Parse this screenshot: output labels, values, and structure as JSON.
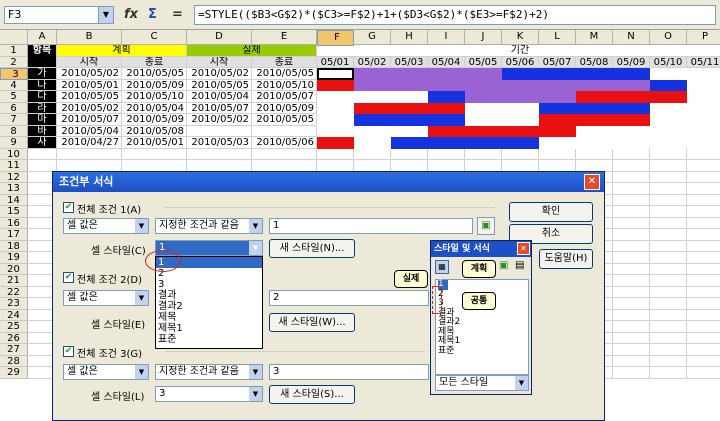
{
  "formula_bar": {
    "cell_ref": "F3",
    "fx_icon": "function-wizard-icon",
    "sum_icon": "sum-icon",
    "eq": "=",
    "formula": "=STYLE(($B3<G$2)*($C3>=F$2)+1+($D3<G$2)*($E3>=F$2)+2)"
  },
  "columns": [
    "A",
    "B",
    "C",
    "D",
    "E",
    "F",
    "G",
    "H",
    "I",
    "J",
    "K",
    "L",
    "M",
    "N",
    "O",
    "P"
  ],
  "rows": [
    "1",
    "2",
    "3",
    "4",
    "5",
    "6",
    "7",
    "8",
    "9",
    "10",
    "11",
    "12",
    "13",
    "14",
    "15",
    "16",
    "17",
    "18",
    "19",
    "20",
    "21",
    "22",
    "23",
    "24",
    "25",
    "26",
    "27",
    "28",
    "29"
  ],
  "sheet": {
    "header1": {
      "item": "항목",
      "plan": "계획",
      "actual": "실제",
      "period": "기간"
    },
    "header2": {
      "start1": "시작",
      "end1": "종료",
      "start2": "시작",
      "end2": "종료"
    },
    "dates": [
      "05/01",
      "05/02",
      "05/03",
      "05/04",
      "05/05",
      "05/06",
      "05/07",
      "05/08",
      "05/09",
      "05/10",
      "05/11"
    ],
    "data": [
      {
        "item": "가",
        "ps": "2010/05/02",
        "pe": "2010/05/05",
        "as": "2010/05/02",
        "ae": "2010/05/05"
      },
      {
        "item": "나",
        "ps": "2010/05/01",
        "pe": "2010/05/09",
        "as": "2010/05/05",
        "ae": "2010/05/10"
      },
      {
        "item": "다",
        "ps": "2010/05/05",
        "pe": "2010/05/10",
        "as": "2010/05/04",
        "ae": "2010/05/07"
      },
      {
        "item": "라",
        "ps": "2010/05/02",
        "pe": "2010/05/04",
        "as": "2010/05/07",
        "ae": "2010/05/09"
      },
      {
        "item": "마",
        "ps": "2010/05/07",
        "pe": "2010/05/09",
        "as": "2010/05/02",
        "ae": "2010/05/05"
      },
      {
        "item": "바",
        "ps": "2010/05/04",
        "pe": "2010/05/08",
        "as": "",
        "ae": ""
      },
      {
        "item": "사",
        "ps": "2010/04/27",
        "pe": "2010/05/01",
        "as": "2010/05/03",
        "ae": "2010/05/06"
      }
    ]
  },
  "gantt": {
    "colors": {
      "plan": "#e81010",
      "actual": "#1432e0",
      "common": "#9b62d4"
    },
    "rows": [
      [
        "w",
        "c",
        "c",
        "c",
        "c",
        "b",
        "b",
        "b",
        "b",
        "w",
        "w"
      ],
      [
        "r",
        "c",
        "c",
        "c",
        "c",
        "c",
        "c",
        "c",
        "c",
        "b",
        "w"
      ],
      [
        "w",
        "w",
        "w",
        "b",
        "c",
        "c",
        "c",
        "r",
        "r",
        "r",
        "w"
      ],
      [
        "w",
        "r",
        "r",
        "r",
        "w",
        "w",
        "b",
        "b",
        "b",
        "w",
        "w"
      ],
      [
        "w",
        "b",
        "b",
        "b",
        "w",
        "w",
        "r",
        "r",
        "r",
        "w",
        "w"
      ],
      [
        "w",
        "w",
        "w",
        "r",
        "r",
        "r",
        "r",
        "w",
        "w",
        "w",
        "w"
      ],
      [
        "r",
        "w",
        "b",
        "b",
        "b",
        "b",
        "w",
        "w",
        "w",
        "w",
        "w"
      ]
    ]
  },
  "dialog": {
    "title": "조건부 서식",
    "close": "✕",
    "cond1": {
      "label": "전체 조건 1(A)",
      "type": "셀 값은",
      "op": "지정한 조건과 같음",
      "value": "1",
      "style_label": "셀 스타일(C)",
      "style": "1",
      "new_style": "새 스타일(N)..."
    },
    "cond2": {
      "label": "전체 조건 2(D)",
      "type": "셀 값은",
      "value": "2",
      "style_label": "셀 스타일(E)",
      "new_style": "새 스타일(W)..."
    },
    "cond3": {
      "label": "전체 조건 3(G)",
      "type": "셀 값은",
      "op": "지정한 조건과 같음",
      "value": "3",
      "style_label": "셀 스타일(L)",
      "style": "3",
      "new_style": "새 스타일(S)..."
    },
    "ok": "확인",
    "cancel": "취소",
    "help": "도움말(H)",
    "dropdown": [
      "1",
      "2",
      "3",
      "결과",
      "결과2",
      "제목",
      "제목1",
      "표준"
    ]
  },
  "styles_panel": {
    "title": "스타일 및 서식",
    "items": [
      "1",
      "2",
      "3",
      "결과",
      "결과2",
      "제목",
      "제목1",
      "표준"
    ],
    "filter": "모든 스타일"
  },
  "callouts": {
    "plan": "계획",
    "actual": "실제",
    "common": "공통"
  }
}
